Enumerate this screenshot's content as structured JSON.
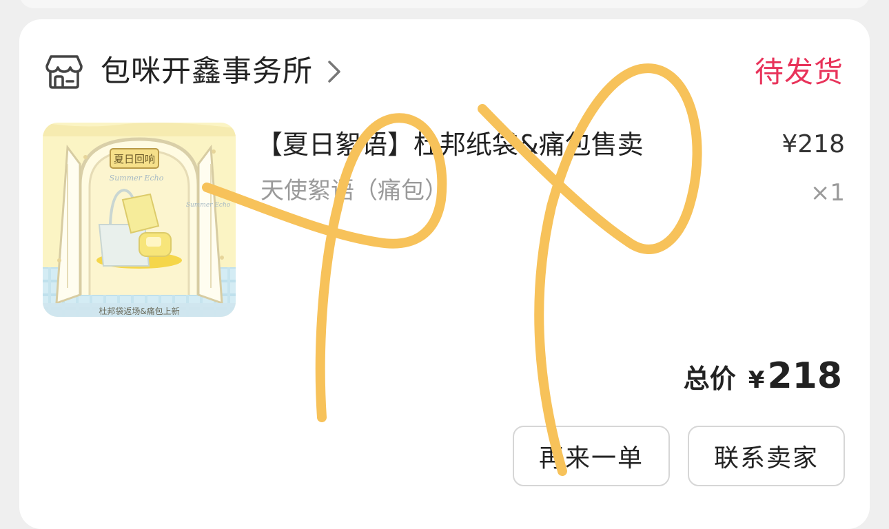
{
  "order": {
    "shop_name": "包咪开鑫事务所",
    "status": "待发货",
    "item": {
      "title": "【夏日絮语】杜邦纸袋&痛包售卖",
      "spec": "天使絮语（痛包）",
      "price": "¥218",
      "quantity": "×1",
      "thumbnail": {
        "sign_text": "夏日回响",
        "script_text": "Summer Echo",
        "side_text": "Summer Echo",
        "caption": "杜邦袋返场&痛包上新"
      }
    },
    "total": {
      "label": "总价",
      "currency": "¥",
      "value": "218"
    },
    "actions": {
      "reorder_label": "再来一单",
      "contact_label": "联系卖家"
    }
  },
  "colors": {
    "status_accent": "#e8335a",
    "scribble": "#f7c25a"
  },
  "icons": {
    "shop": "store-icon",
    "chevron": "chevron-right-icon"
  }
}
